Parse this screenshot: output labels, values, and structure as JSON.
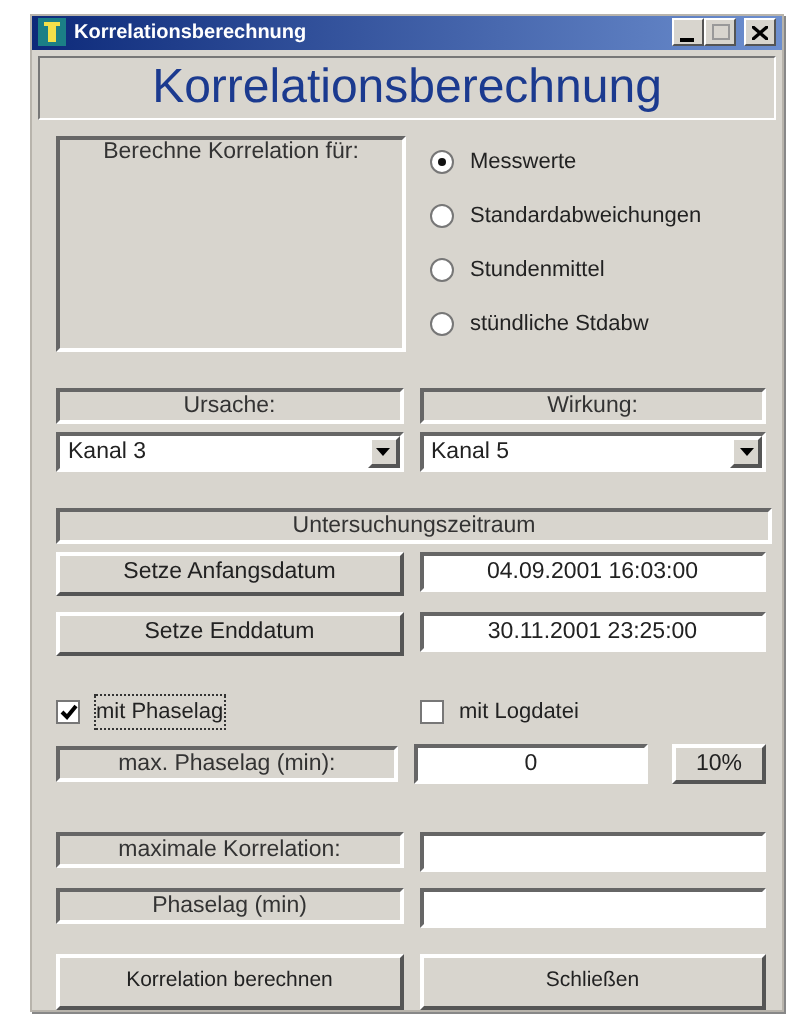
{
  "window": {
    "title": "Korrelationsberechnung"
  },
  "header": "Korrelationsberechnung",
  "mode_group": {
    "label": "Berechne Korrelation für:",
    "options": [
      {
        "label": "Messwerte",
        "selected": true
      },
      {
        "label": "Standardabweichungen",
        "selected": false
      },
      {
        "label": "Stundenmittel",
        "selected": false
      },
      {
        "label": "stündliche Stdabw",
        "selected": false
      }
    ]
  },
  "channels": [
    {
      "label": "Ursache:",
      "value": "Kanal 3"
    },
    {
      "label": "Wirkung:",
      "value": "Kanal 5"
    }
  ],
  "period": {
    "label": "Untersuchungszeitraum",
    "rows": [
      {
        "button": "Setze Anfangsdatum",
        "value": "04.09.2001 16:03:00"
      },
      {
        "button": "Setze Enddatum",
        "value": "30.11.2001 23:25:00"
      }
    ]
  },
  "options": [
    {
      "label": "mit Phaselag",
      "checked": true,
      "focused": true
    },
    {
      "label": "mit Logdatei",
      "checked": false,
      "focused": false
    }
  ],
  "max_phaselag": {
    "label": "max. Phaselag (min):",
    "value": "0",
    "button": "10%"
  },
  "results": [
    {
      "label": "maximale Korrelation:"
    },
    {
      "label": "Phaselag (min)"
    }
  ],
  "buttons": [
    "Korrelation berechnen",
    "Schließen"
  ]
}
